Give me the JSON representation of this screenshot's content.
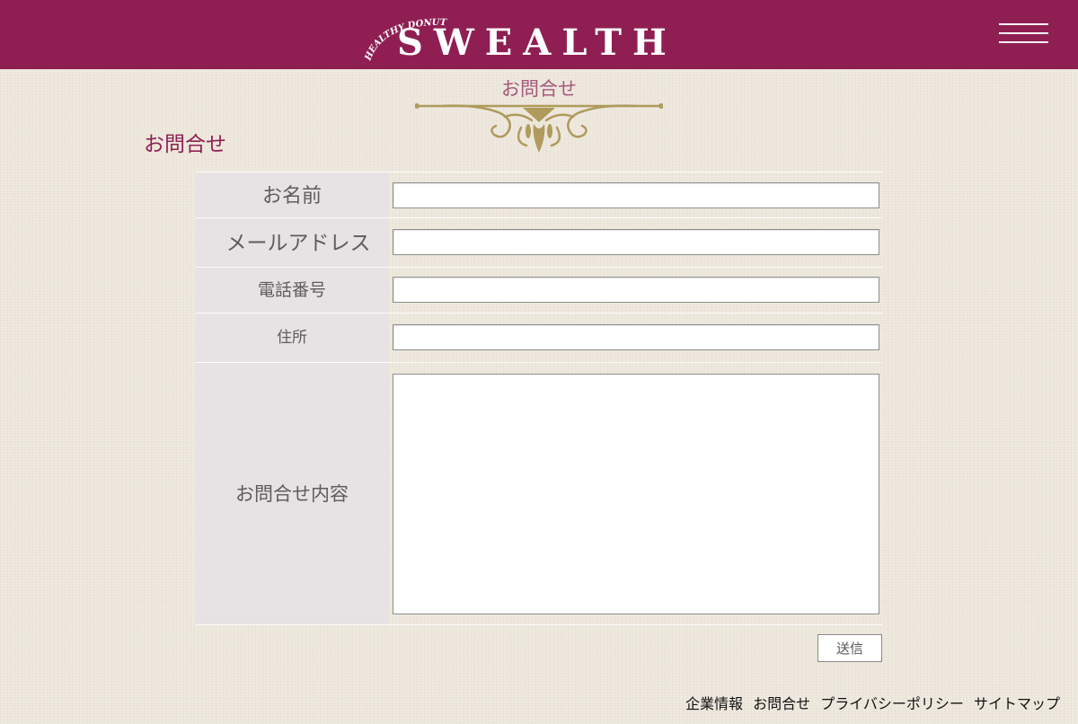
{
  "header": {
    "logo_tagline": "HEALTHY DONUTS",
    "logo_text": "SWEALTH",
    "menu_icon": "hamburger-menu-icon",
    "background_color": "#8f1f53"
  },
  "page": {
    "heading": "お問合せ",
    "ornament_icon": "gold-flourish-divider",
    "section_title": "お問合せ"
  },
  "form": {
    "fields": [
      {
        "label": "お名前",
        "value": ""
      },
      {
        "label": "メールアドレス",
        "value": ""
      },
      {
        "label": "電話番号",
        "value": ""
      },
      {
        "label": "住所",
        "value": ""
      },
      {
        "label": "お問合せ内容",
        "value": ""
      }
    ],
    "submit_label": "送信"
  },
  "footer": {
    "links": [
      "企業情報",
      "お問合せ",
      "プライバシーポリシー",
      "サイトマップ"
    ]
  },
  "colors": {
    "accent": "#8f1f53",
    "ornament_gold": "#b09a5c",
    "label_background": "#e7e2e3",
    "page_background": "#ede7dc"
  }
}
